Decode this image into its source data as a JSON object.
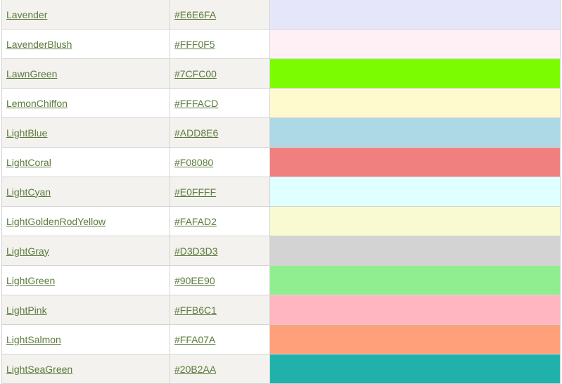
{
  "colors": [
    {
      "name": "Lavender",
      "hex": "#E6E6FA"
    },
    {
      "name": "LavenderBlush",
      "hex": "#FFF0F5"
    },
    {
      "name": "LawnGreen",
      "hex": "#7CFC00"
    },
    {
      "name": "LemonChiffon",
      "hex": "#FFFACD"
    },
    {
      "name": "LightBlue",
      "hex": "#ADD8E6"
    },
    {
      "name": "LightCoral",
      "hex": "#F08080"
    },
    {
      "name": "LightCyan",
      "hex": "#E0FFFF"
    },
    {
      "name": "LightGoldenRodYellow",
      "hex": "#FAFAD2"
    },
    {
      "name": "LightGray",
      "hex": "#D3D3D3"
    },
    {
      "name": "LightGreen",
      "hex": "#90EE90"
    },
    {
      "name": "LightPink",
      "hex": "#FFB6C1"
    },
    {
      "name": "LightSalmon",
      "hex": "#FFA07A"
    },
    {
      "name": "LightSeaGreen",
      "hex": "#20B2AA"
    }
  ],
  "theme": {
    "link_color": "#5c7a3c",
    "row_alt_bg": "#f3f2ee",
    "border_color": "#d4d4d4"
  }
}
